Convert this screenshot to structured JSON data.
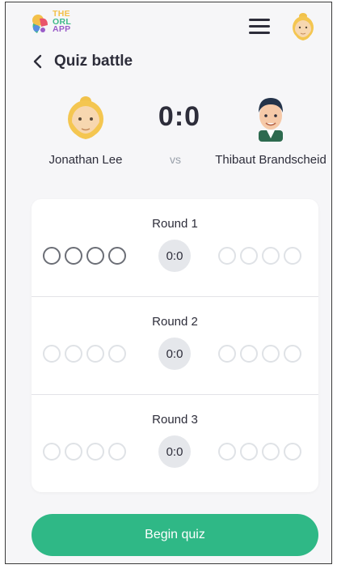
{
  "app": {
    "logo_lines": [
      "THE",
      "ORL",
      "APP"
    ]
  },
  "header": {
    "menu_icon": "hamburger-menu-icon",
    "profile_icon": "profile-avatar"
  },
  "page": {
    "title": "Quiz battle",
    "back_icon": "chevron-left-icon"
  },
  "battle": {
    "player_left": {
      "name": "Jonathan Lee"
    },
    "player_right": {
      "name": "Thibaut Brandscheid"
    },
    "score": "0:0",
    "vs_label": "vs"
  },
  "rounds": [
    {
      "label": "Round 1",
      "score": "0:0",
      "active": true
    },
    {
      "label": "Round 2",
      "score": "0:0",
      "active": false
    },
    {
      "label": "Round 3",
      "score": "0:0",
      "active": false
    }
  ],
  "actions": {
    "begin_label": "Begin quiz"
  },
  "colors": {
    "primary": "#2fb886",
    "text": "#2d2d3a",
    "muted": "#9aa1ab",
    "background": "#f6f6f8"
  }
}
